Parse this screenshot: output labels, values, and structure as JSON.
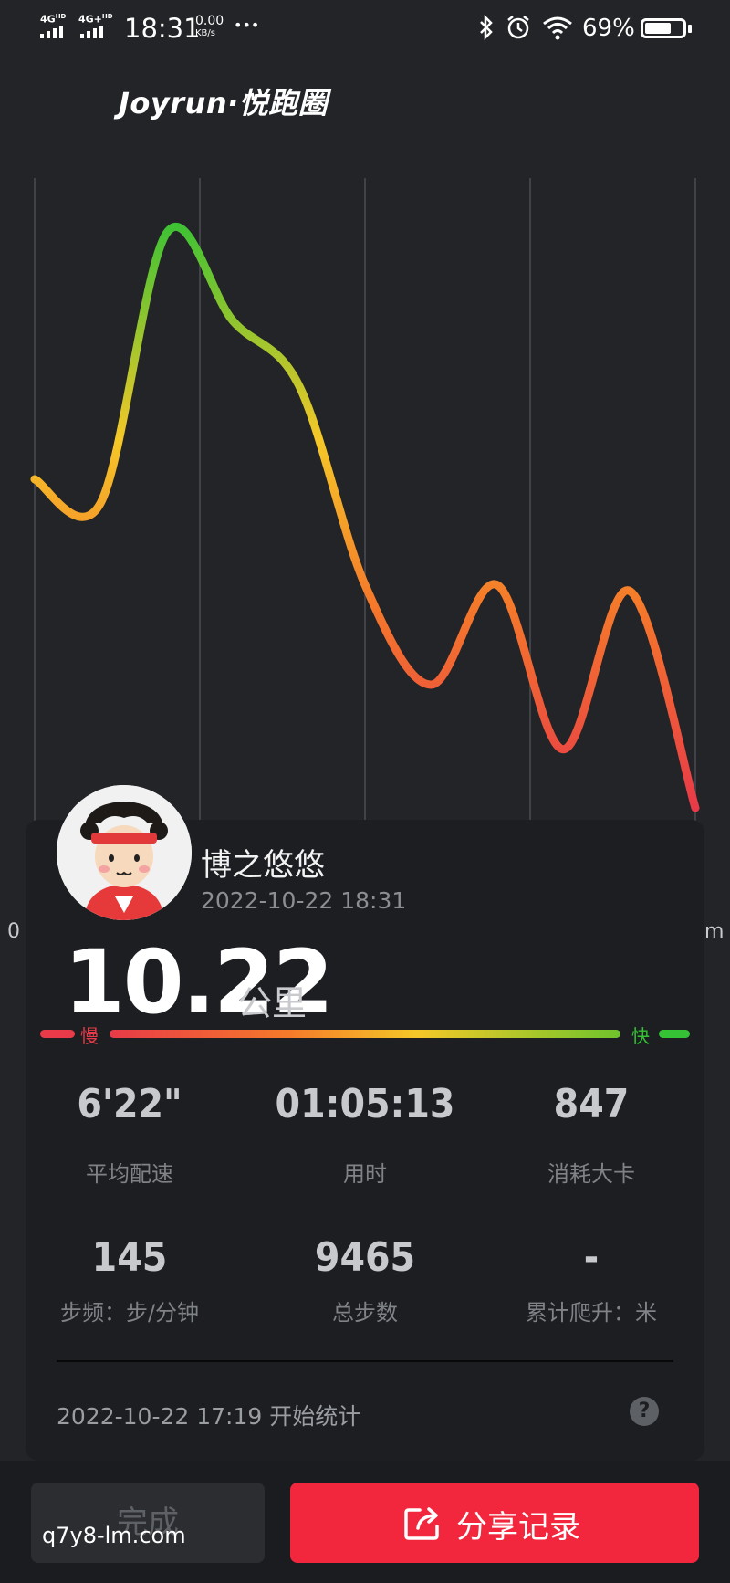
{
  "status_bar": {
    "signal1": "4G",
    "signal1_sup": "HD",
    "signal2": "4G+",
    "signal2_sup": "HD",
    "time": "18:31",
    "speed_value": "0.00",
    "speed_unit": "KB/s",
    "more": "•••",
    "battery": "69%",
    "battery_level": 0.69
  },
  "app": {
    "logo": "Joyrun·悦跑圈"
  },
  "chart_data": {
    "type": "line",
    "x": [
      0,
      1,
      2,
      3,
      4,
      5,
      6,
      7,
      8,
      9,
      10
    ],
    "y": [
      56,
      52,
      98,
      83,
      72,
      38,
      21,
      38,
      10,
      37,
      0
    ],
    "xlabel_left": "0",
    "xlabel_right": "m",
    "gradient": [
      "#e83a48",
      "#f57a2a",
      "#f5c828",
      "#35c235"
    ]
  },
  "profile": {
    "name": "博之悠悠",
    "datetime": "2022-10-22 18:31"
  },
  "distance": {
    "value": "10.22",
    "unit": "公里"
  },
  "pace_legend": {
    "slow": "慢",
    "fast": "快"
  },
  "stats": [
    {
      "value": "6'22\"",
      "label": "平均配速"
    },
    {
      "value": "01:05:13",
      "label": "用时"
    },
    {
      "value": "847",
      "label": "消耗大卡"
    },
    {
      "value": "145",
      "label": "步频：步/分钟"
    },
    {
      "value": "9465",
      "label": "总步数"
    },
    {
      "value": "-",
      "label": "累计爬升：米"
    }
  ],
  "footer": {
    "start_text": "2022-10-22 17:19  开始统计",
    "help": "?"
  },
  "buttons": {
    "done": "完成",
    "share": "分享记录"
  },
  "watermark": "q7y8-lm.com"
}
